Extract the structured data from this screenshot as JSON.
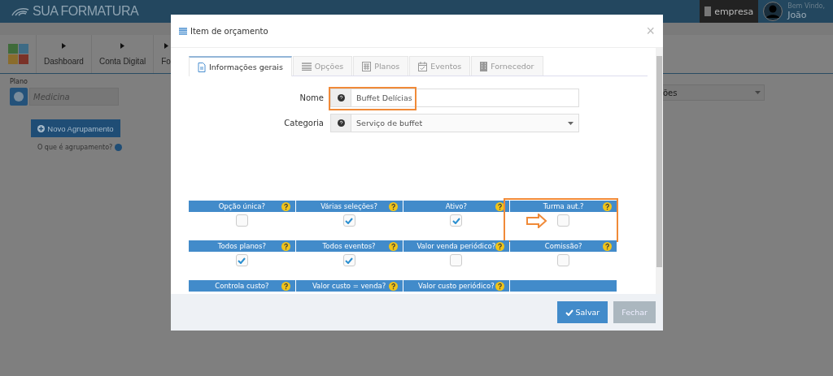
{
  "header": {
    "brand": "SUA FORMATURA",
    "company": "empresa",
    "greeting": "Bem Vindo,",
    "user": "João"
  },
  "nav": {
    "items": [
      {
        "label": "Dashboard"
      },
      {
        "label": "Conta Digital"
      },
      {
        "label": "Fo"
      }
    ]
  },
  "sidebar": {
    "plan_label": "Plano",
    "plan_value": "Medicina",
    "new_group_button": "Novo Agrupamento",
    "help_link": "O que é agrupamento?"
  },
  "background_select": {
    "value": "ões"
  },
  "modal": {
    "title": "Item de orçamento",
    "close_symbol": "×",
    "tabs": [
      {
        "label": "Informações gerais",
        "selected": true
      },
      {
        "label": "Opções",
        "selected": false
      },
      {
        "label": "Planos",
        "selected": false
      },
      {
        "label": "Eventos",
        "selected": false
      },
      {
        "label": "Fornecedor",
        "selected": false
      }
    ],
    "fields": [
      {
        "kind": "text",
        "label": "Nome",
        "value": "Buffet Delícias",
        "highlighted": true
      },
      {
        "kind": "select",
        "label": "Categoria",
        "value": "Serviço de buffet",
        "highlighted": false
      }
    ],
    "options": [
      [
        {
          "kind": "checkbox",
          "label": "Opção única?",
          "checked": false,
          "highlighted": false
        },
        {
          "kind": "checkbox",
          "label": "Várias seleções?",
          "checked": true,
          "highlighted": false
        },
        {
          "kind": "checkbox",
          "label": "Ativo?",
          "checked": true,
          "highlighted": false
        },
        {
          "kind": "checkbox",
          "label": "Turma aut.?",
          "checked": false,
          "highlighted": true
        }
      ],
      [
        {
          "kind": "checkbox",
          "label": "Todos planos?",
          "checked": true,
          "highlighted": false
        },
        {
          "kind": "checkbox",
          "label": "Todos eventos?",
          "checked": true,
          "highlighted": false
        },
        {
          "kind": "checkbox",
          "label": "Valor venda periódico?",
          "checked": false,
          "highlighted": false
        },
        {
          "kind": "checkbox",
          "label": "Comissão?",
          "checked": false,
          "highlighted": false
        }
      ],
      [
        {
          "kind": "header",
          "label": "Controla custo?"
        },
        {
          "kind": "header",
          "label": "Valor custo = venda?"
        },
        {
          "kind": "header",
          "label": "Valor custo periódico?"
        },
        {
          "kind": "blank"
        }
      ]
    ],
    "buttons": [
      {
        "label": "Salvar",
        "kind": "primary"
      },
      {
        "label": "Fechar",
        "kind": "secondary"
      }
    ]
  }
}
